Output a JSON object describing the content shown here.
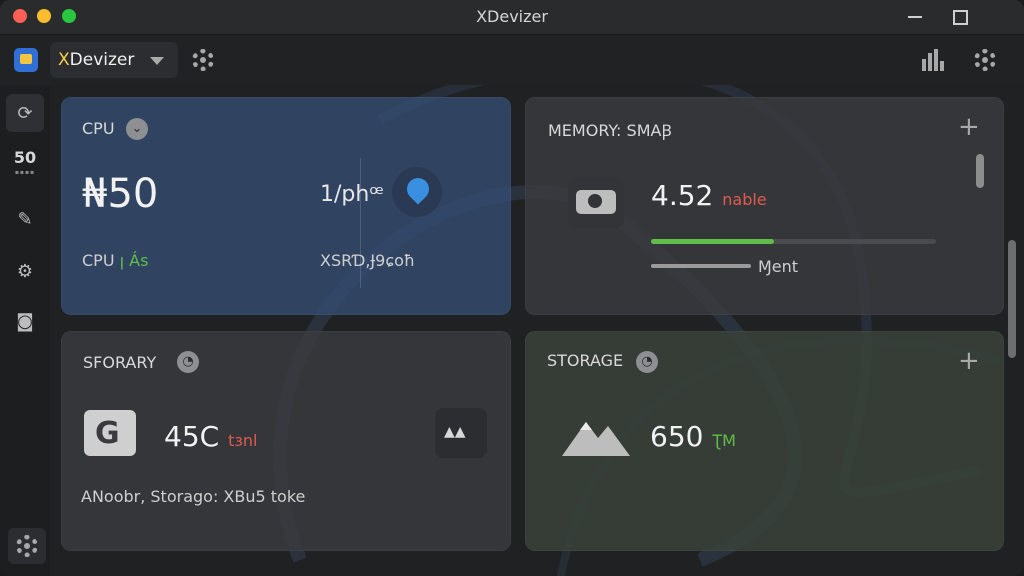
{
  "window": {
    "title": "XDevizer"
  },
  "toolbar": {
    "app_name_first": "X",
    "app_name_rest": "Devizer"
  },
  "sidebar": {
    "items": [
      {
        "icon": "refresh-icon"
      },
      {
        "icon": "fifty-icon",
        "label": "50"
      },
      {
        "icon": "puzzle-icon"
      },
      {
        "icon": "gear-icon"
      },
      {
        "icon": "camera-icon"
      }
    ]
  },
  "cards": {
    "cpu": {
      "title": "CPU",
      "value": "₦50",
      "sub_label": "CPU",
      "sub_tag": "ꞁ Ás",
      "secondary_value": "1/phꟹ",
      "secondary_label": "XSRƊ,Ɉ9ɕoħ"
    },
    "memory": {
      "title": "MEMORY: SMAꞴ",
      "value": "4.52",
      "value_tag": "nable",
      "progress": 0.43,
      "sub_label": "Ɱent"
    },
    "sforary": {
      "title": "SFORARY",
      "value": "45C",
      "value_tag": "tɜnl",
      "footer": "ANoobr, Storago: XBu5 toke"
    },
    "storage": {
      "title": "STORAGE",
      "value": "650",
      "value_tag": "ƮM"
    }
  },
  "colors": {
    "cpu_card": "#344c70",
    "accent_green": "#5fbd4a",
    "accent_red": "#e05a4f",
    "accent_blue": "#3a8fe0"
  }
}
